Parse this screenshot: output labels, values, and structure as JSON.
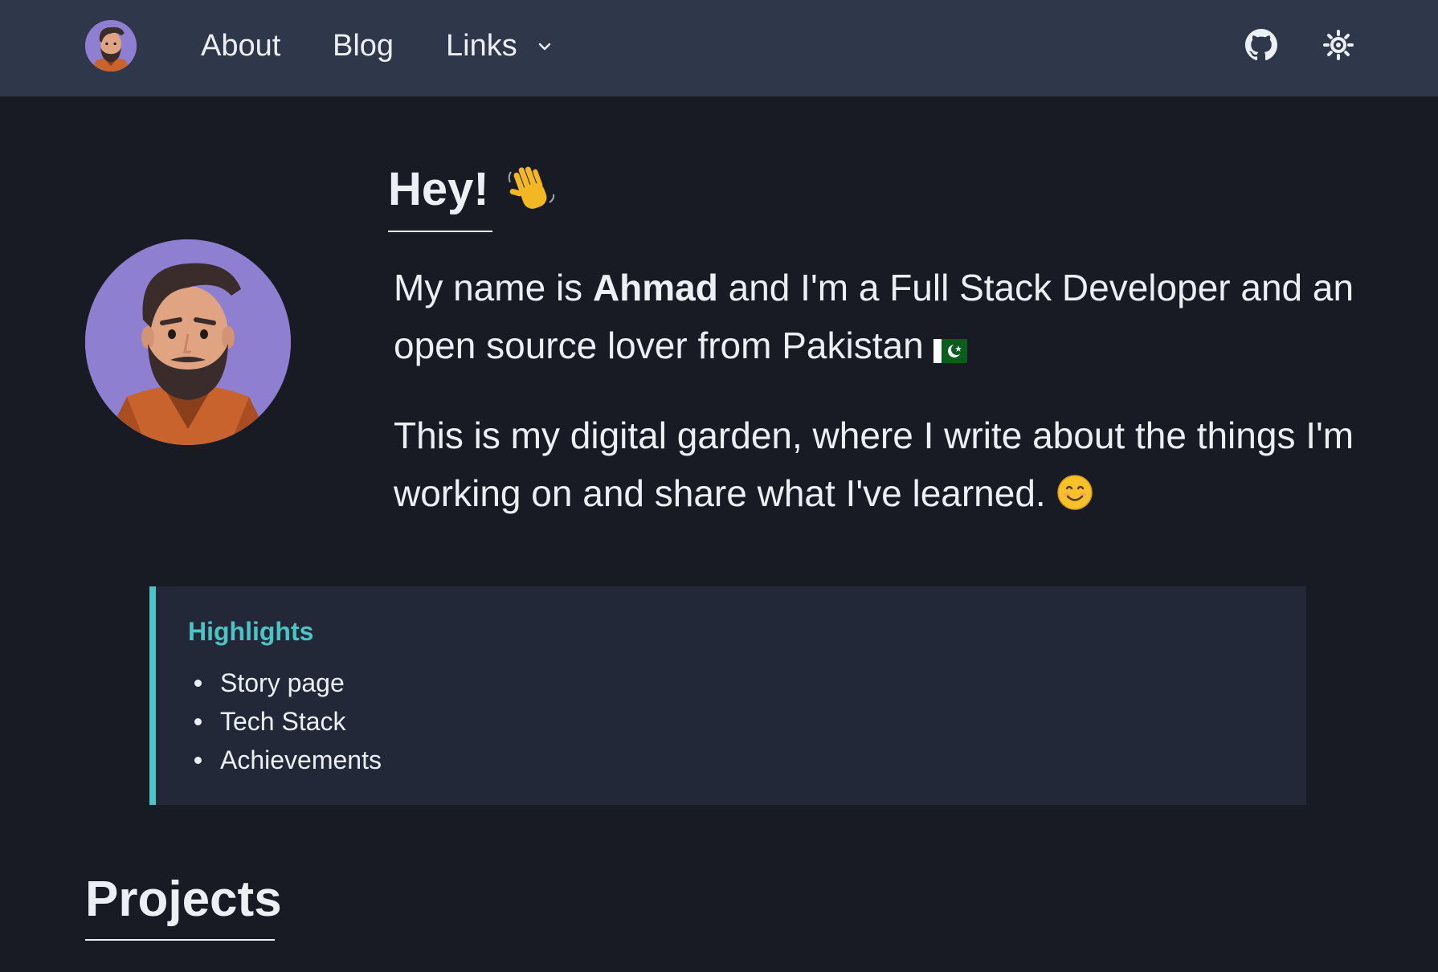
{
  "nav": {
    "about": "About",
    "blog": "Blog",
    "links": "Links"
  },
  "icons": {
    "avatar": "avatar-icon",
    "chevron": "chevron-down-icon",
    "github": "github-icon",
    "theme": "sun-icon",
    "wave": "waving-hand-emoji",
    "flag": "pakistan-flag-emoji",
    "smile": "smiling-face-emoji"
  },
  "hero": {
    "title": "Hey!",
    "p1_before": "My name is ",
    "p1_name": "Ahmad",
    "p1_after": " and I'm a Full Stack Developer and an open source lover from Pakistan",
    "p2": "This is my digital garden, where I write about the things I'm working on and share what I've learned."
  },
  "highlights": {
    "title": "Highlights",
    "items": [
      "Story page",
      "Tech Stack",
      "Achievements"
    ]
  },
  "projects": {
    "title": "Projects"
  },
  "colors": {
    "background": "#181b24",
    "navbar": "#2f374b",
    "callout_bg": "#222838",
    "accent": "#4fc3c3",
    "avatar_bg": "#8f7fd0"
  }
}
